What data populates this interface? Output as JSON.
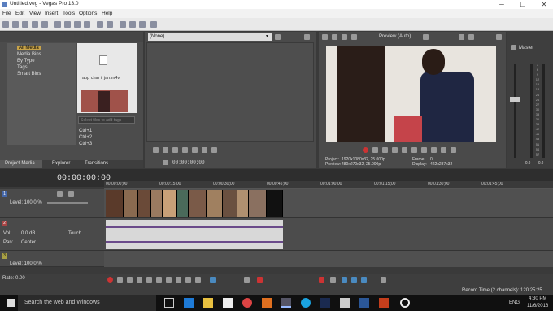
{
  "window": {
    "title": "Untitled.veg - Vegas Pro 13.0",
    "minimize": "─",
    "maximize": "☐",
    "close": "✕"
  },
  "menu": [
    "File",
    "Edit",
    "View",
    "Insert",
    "Tools",
    "Options",
    "Help"
  ],
  "explorer": {
    "tree": [
      "All Media",
      "Media Bins",
      "By Type",
      "Tags",
      "Smart Bins"
    ],
    "file_name": "app char ij jan.m4v",
    "tags_placeholder": "Select files to add tags",
    "shortcuts": [
      "Ctrl+1",
      "Ctrl+2",
      "Ctrl+3"
    ],
    "tabs": [
      "Project Media",
      "Explorer",
      "Transitions"
    ]
  },
  "trimmer": {
    "dropdown": "(None)",
    "timecode": "00:00:00;00"
  },
  "preview": {
    "mode": "Preview (Auto)",
    "project_label": "Project:",
    "project_value": "1920x1080x32, 25.000p",
    "preview_label": "Preview:",
    "preview_value": "480x270x32, 25.000p",
    "frame_label": "Frame:",
    "frame_value": "0",
    "display_label": "Display:",
    "display_value": "422x237x32"
  },
  "master": {
    "label": "Master",
    "scale": [
      "3",
      "6",
      "9",
      "12",
      "15",
      "18",
      "21",
      "24",
      "27",
      "30",
      "33",
      "36",
      "39",
      "42",
      "45",
      "48",
      "51",
      "54",
      "57"
    ],
    "bottom": [
      "0.0",
      "0.0"
    ]
  },
  "timeline": {
    "timecode": "00:00:00:00",
    "ruler": [
      "00:00:00;00",
      "00:00:15;00",
      "00:00:30;00",
      "00:00:45;00",
      "00:01:00;00",
      "00:01:15;00",
      "00:01:30;00",
      "00:01:45;00"
    ],
    "video_track": {
      "number": "1",
      "level": "Level: 100.0 %"
    },
    "audio_track": {
      "number": "2",
      "vol": "Vol:",
      "vol_value": "0.0 dB",
      "pan": "Pan:",
      "pan_value": "Center",
      "mode": "Touch"
    },
    "video_track2": {
      "number": "3",
      "level": "Level: 100.0 %"
    },
    "rate": "Rate: 0.00",
    "record_time": "Record Time (2 channels): 120:25:25"
  },
  "taskbar": {
    "search": "Search the web and Windows",
    "time": "4:30 PM",
    "date": "11/6/2016",
    "lang": "ENG"
  }
}
